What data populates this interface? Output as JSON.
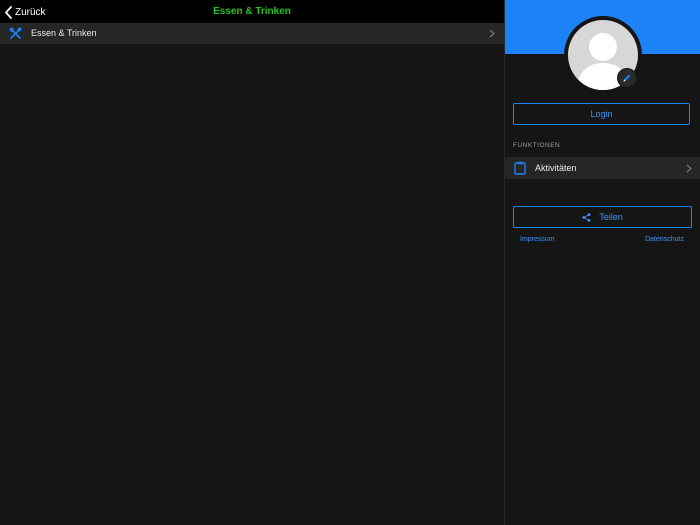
{
  "navbar": {
    "back_label": "Zurück",
    "title": "Essen & Trinken"
  },
  "list": {
    "items": [
      {
        "label": "Essen & Trinken",
        "icon": "fork-knife-icon"
      }
    ]
  },
  "sidebar": {
    "login_label": "Login",
    "section_label": "FUNKTIONEN",
    "features": [
      {
        "label": "Aktivitäten",
        "icon": "clipboard-icon"
      }
    ],
    "share_label": "Teilen",
    "impressum_label": "Impressum",
    "datenschutz_label": "Datenschutz"
  },
  "colors": {
    "accent": "#1b82f7",
    "title_green": "#24c425",
    "background": "#151515",
    "row_background": "#262626"
  }
}
